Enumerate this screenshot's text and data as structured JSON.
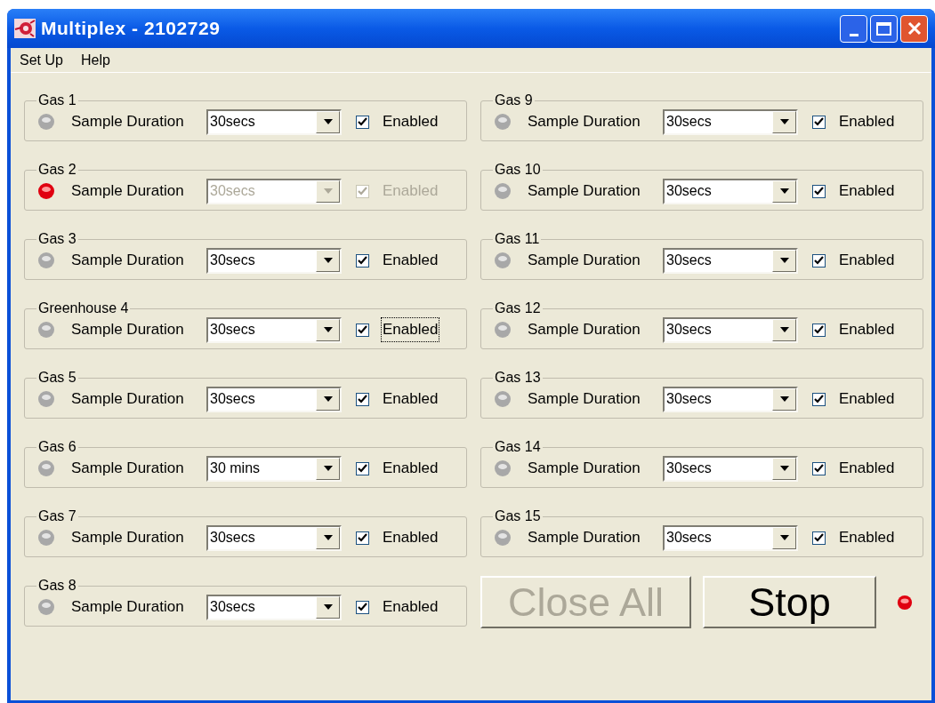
{
  "window": {
    "title": "Multiplex - 2102729"
  },
  "menu": [
    {
      "label": "Set Up"
    },
    {
      "label": "Help"
    }
  ],
  "groups": [
    {
      "name": "Gas 1",
      "lit": false,
      "label": "Sample Duration",
      "duration": "30secs",
      "checkbox_label": "Enabled",
      "enabled": true,
      "disabled": false,
      "focused": false
    },
    {
      "name": "Gas 2",
      "lit": true,
      "label": "Sample Duration",
      "duration": "30secs",
      "checkbox_label": "Enabled",
      "enabled": true,
      "disabled": true,
      "focused": false
    },
    {
      "name": "Gas 3",
      "lit": false,
      "label": "Sample Duration",
      "duration": "30secs",
      "checkbox_label": "Enabled",
      "enabled": true,
      "disabled": false,
      "focused": false
    },
    {
      "name": "Greenhouse 4",
      "lit": false,
      "label": "Sample Duration",
      "duration": "30secs",
      "checkbox_label": "Enabled",
      "enabled": true,
      "disabled": false,
      "focused": true
    },
    {
      "name": "Gas 5",
      "lit": false,
      "label": "Sample Duration",
      "duration": "30secs",
      "checkbox_label": "Enabled",
      "enabled": true,
      "disabled": false,
      "focused": false
    },
    {
      "name": "Gas 6",
      "lit": false,
      "label": "Sample Duration",
      "duration": "30 mins",
      "checkbox_label": "Enabled",
      "enabled": true,
      "disabled": false,
      "focused": false
    },
    {
      "name": "Gas 7",
      "lit": false,
      "label": "Sample Duration",
      "duration": "30secs",
      "checkbox_label": "Enabled",
      "enabled": true,
      "disabled": false,
      "focused": false
    },
    {
      "name": "Gas 8",
      "lit": false,
      "label": "Sample Duration",
      "duration": "30secs",
      "checkbox_label": "Enabled",
      "enabled": true,
      "disabled": false,
      "focused": false
    },
    {
      "name": "Gas 9",
      "lit": false,
      "label": "Sample Duration",
      "duration": "30secs",
      "checkbox_label": "Enabled",
      "enabled": true,
      "disabled": false,
      "focused": false
    },
    {
      "name": "Gas 10",
      "lit": false,
      "label": "Sample Duration",
      "duration": "30secs",
      "checkbox_label": "Enabled",
      "enabled": true,
      "disabled": false,
      "focused": false
    },
    {
      "name": "Gas 11",
      "lit": false,
      "label": "Sample Duration",
      "duration": "30secs",
      "checkbox_label": "Enabled",
      "enabled": true,
      "disabled": false,
      "focused": false
    },
    {
      "name": "Gas 12",
      "lit": false,
      "label": "Sample Duration",
      "duration": "30secs",
      "checkbox_label": "Enabled",
      "enabled": true,
      "disabled": false,
      "focused": false
    },
    {
      "name": "Gas 13",
      "lit": false,
      "label": "Sample Duration",
      "duration": "30secs",
      "checkbox_label": "Enabled",
      "enabled": true,
      "disabled": false,
      "focused": false
    },
    {
      "name": "Gas 14",
      "lit": false,
      "label": "Sample Duration",
      "duration": "30secs",
      "checkbox_label": "Enabled",
      "enabled": true,
      "disabled": false,
      "focused": false
    },
    {
      "name": "Gas 15",
      "lit": false,
      "label": "Sample Duration",
      "duration": "30secs",
      "checkbox_label": "Enabled",
      "enabled": true,
      "disabled": false,
      "focused": false
    }
  ],
  "buttons": [
    {
      "label": "Close All",
      "disabled": true
    },
    {
      "label": "Stop",
      "disabled": false
    }
  ],
  "status_lit": true
}
